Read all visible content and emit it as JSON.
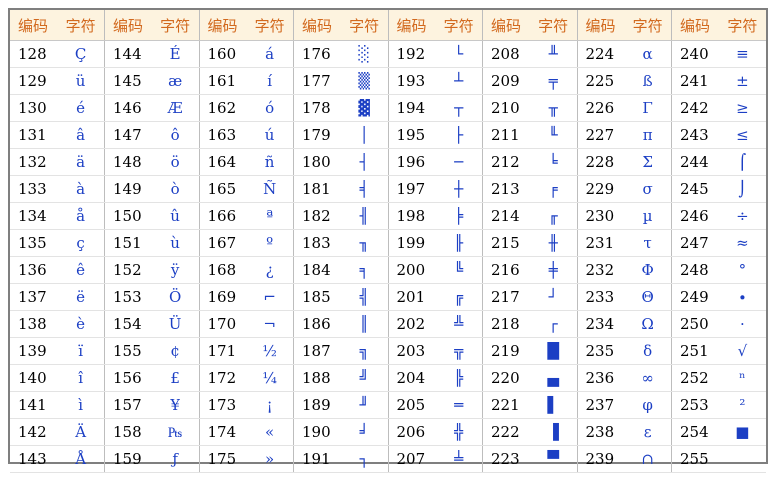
{
  "headers": {
    "code": "编码",
    "char": "字符"
  },
  "columns": [
    {
      "codes": [
        "128",
        "129",
        "130",
        "131",
        "132",
        "133",
        "134",
        "135",
        "136",
        "137",
        "138",
        "139",
        "140",
        "141",
        "142",
        "143"
      ],
      "chars": [
        "Ç",
        "ü",
        "é",
        "â",
        "ä",
        "à",
        "å",
        "ç",
        "ê",
        "ë",
        "è",
        "ï",
        "î",
        "ì",
        "Ä",
        "Å"
      ]
    },
    {
      "codes": [
        "144",
        "145",
        "146",
        "147",
        "148",
        "149",
        "150",
        "151",
        "152",
        "153",
        "154",
        "155",
        "156",
        "157",
        "158",
        "159"
      ],
      "chars": [
        "É",
        "æ",
        "Æ",
        "ô",
        "ö",
        "ò",
        "û",
        "ù",
        "ÿ",
        "Ö",
        "Ü",
        "¢",
        "£",
        "¥",
        "₧",
        "ƒ"
      ]
    },
    {
      "codes": [
        "160",
        "161",
        "162",
        "163",
        "164",
        "165",
        "166",
        "167",
        "168",
        "169",
        "170",
        "171",
        "172",
        "173",
        "174",
        "175"
      ],
      "chars": [
        "á",
        "í",
        "ó",
        "ú",
        "ñ",
        "Ñ",
        "ª",
        "º",
        "¿",
        "⌐",
        "¬",
        "½",
        "¼",
        "¡",
        "«",
        "»"
      ]
    },
    {
      "codes": [
        "176",
        "177",
        "178",
        "179",
        "180",
        "181",
        "182",
        "183",
        "184",
        "185",
        "186",
        "187",
        "188",
        "189",
        "190",
        "191"
      ],
      "chars": [
        "░",
        "▒",
        "▓",
        "│",
        "┤",
        "╡",
        "╢",
        "╖",
        "╕",
        "╣",
        "║",
        "╗",
        "╝",
        "╜",
        "╛",
        "┐"
      ]
    },
    {
      "codes": [
        "192",
        "193",
        "194",
        "195",
        "196",
        "197",
        "198",
        "199",
        "200",
        "201",
        "202",
        "203",
        "204",
        "205",
        "206",
        "207"
      ],
      "chars": [
        "└",
        "┴",
        "┬",
        "├",
        "─",
        "┼",
        "╞",
        "╟",
        "╚",
        "╔",
        "╩",
        "╦",
        "╠",
        "═",
        "╬",
        "╧"
      ]
    },
    {
      "codes": [
        "208",
        "209",
        "210",
        "211",
        "212",
        "213",
        "214",
        "215",
        "216",
        "217",
        "218",
        "219",
        "220",
        "221",
        "222",
        "223"
      ],
      "chars": [
        "╨",
        "╤",
        "╥",
        "╙",
        "╘",
        "╒",
        "╓",
        "╫",
        "╪",
        "┘",
        "┌",
        "█",
        "▄",
        "▌",
        "▐",
        "▀"
      ]
    },
    {
      "codes": [
        "224",
        "225",
        "226",
        "227",
        "228",
        "229",
        "230",
        "231",
        "232",
        "233",
        "234",
        "235",
        "236",
        "237",
        "238",
        "239"
      ],
      "chars": [
        "α",
        "ß",
        "Γ",
        "π",
        "Σ",
        "σ",
        "µ",
        "τ",
        "Φ",
        "Θ",
        "Ω",
        "δ",
        "∞",
        "φ",
        "ε",
        "∩"
      ]
    },
    {
      "codes": [
        "240",
        "241",
        "242",
        "243",
        "244",
        "245",
        "246",
        "247",
        "248",
        "249",
        "250",
        "251",
        "252",
        "253",
        "254",
        "255"
      ],
      "chars": [
        "≡",
        "±",
        "≥",
        "≤",
        "⌠",
        "⌡",
        "÷",
        "≈",
        "°",
        "∙",
        "·",
        "√",
        "ⁿ",
        "²",
        "■",
        ""
      ]
    }
  ]
}
